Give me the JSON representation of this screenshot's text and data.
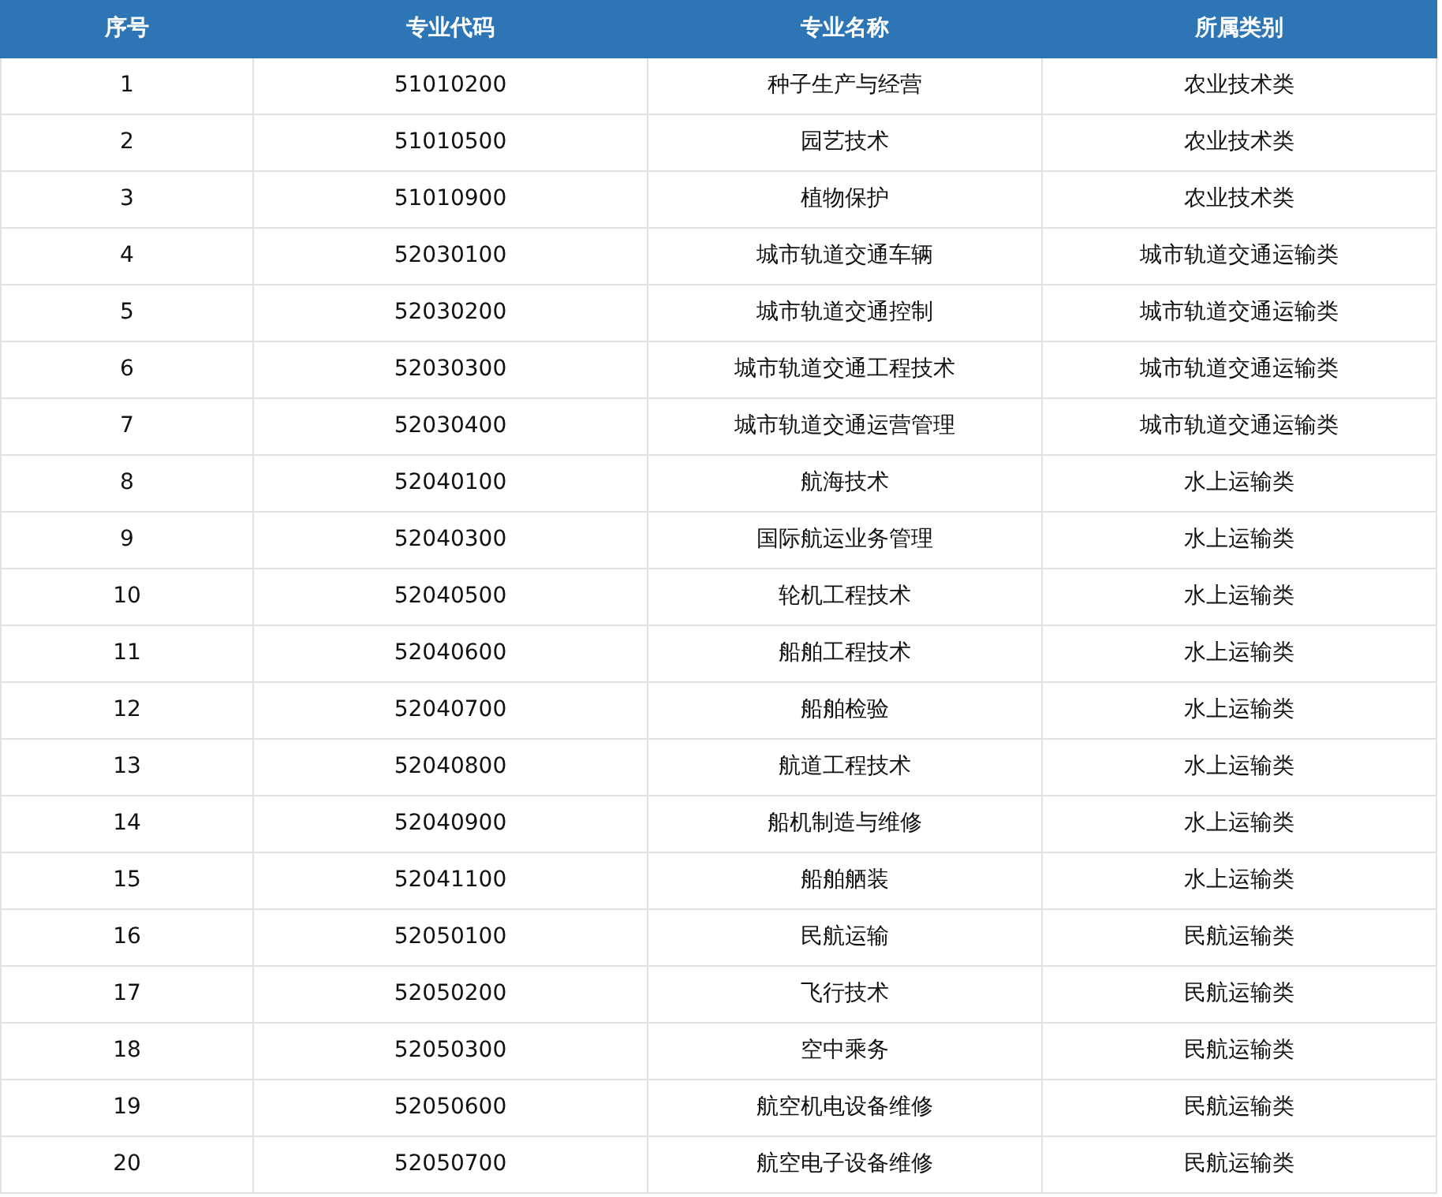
{
  "table": {
    "columns": [
      "序号",
      "专业代码",
      "专业名称",
      "所属类别"
    ],
    "rows": [
      [
        "1",
        "51010200",
        "种子生产与经营",
        "农业技术类"
      ],
      [
        "2",
        "51010500",
        "园艺技术",
        "农业技术类"
      ],
      [
        "3",
        "51010900",
        "植物保护",
        "农业技术类"
      ],
      [
        "4",
        "52030100",
        "城市轨道交通车辆",
        "城市轨道交通运输类"
      ],
      [
        "5",
        "52030200",
        "城市轨道交通控制",
        "城市轨道交通运输类"
      ],
      [
        "6",
        "52030300",
        "城市轨道交通工程技术",
        "城市轨道交通运输类"
      ],
      [
        "7",
        "52030400",
        "城市轨道交通运营管理",
        "城市轨道交通运输类"
      ],
      [
        "8",
        "52040100",
        "航海技术",
        "水上运输类"
      ],
      [
        "9",
        "52040300",
        "国际航运业务管理",
        "水上运输类"
      ],
      [
        "10",
        "52040500",
        "轮机工程技术",
        "水上运输类"
      ],
      [
        "11",
        "52040600",
        "船舶工程技术",
        "水上运输类"
      ],
      [
        "12",
        "52040700",
        "船舶检验",
        "水上运输类"
      ],
      [
        "13",
        "52040800",
        "航道工程技术",
        "水上运输类"
      ],
      [
        "14",
        "52040900",
        "船机制造与维修",
        "水上运输类"
      ],
      [
        "15",
        "52041100",
        "船舶舾装",
        "水上运输类"
      ],
      [
        "16",
        "52050100",
        "民航运输",
        "民航运输类"
      ],
      [
        "17",
        "52050200",
        "飞行技术",
        "民航运输类"
      ],
      [
        "18",
        "52050300",
        "空中乘务",
        "民航运输类"
      ],
      [
        "19",
        "52050600",
        "航空机电设备维修",
        "民航运输类"
      ],
      [
        "20",
        "52050700",
        "航空电子设备维修",
        "民航运输类"
      ]
    ]
  }
}
